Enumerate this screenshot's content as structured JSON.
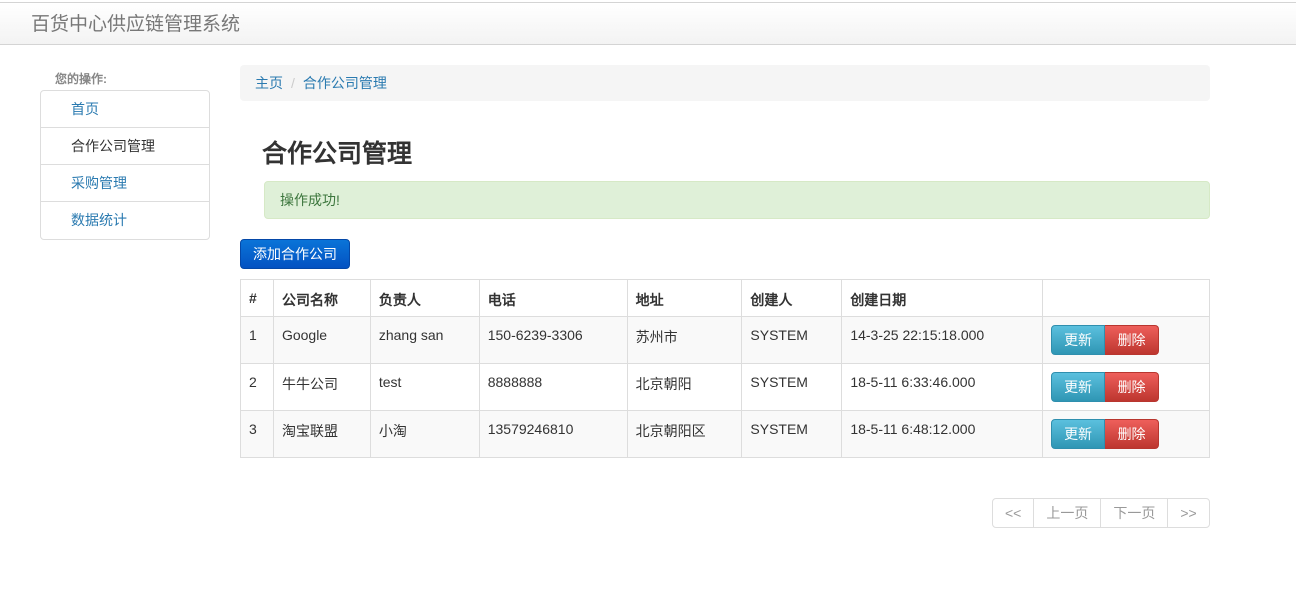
{
  "app": {
    "title": "百货中心供应链管理系统"
  },
  "sidebar": {
    "heading": "您的操作:",
    "items": [
      {
        "label": "首页"
      },
      {
        "label": "合作公司管理"
      },
      {
        "label": "采购管理"
      },
      {
        "label": "数据统计"
      }
    ]
  },
  "breadcrumb": {
    "home": "主页",
    "separator": "/",
    "current": "合作公司管理"
  },
  "page": {
    "title": "合作公司管理"
  },
  "alert": {
    "message": "操作成功!"
  },
  "toolbar": {
    "add_label": "添加合作公司"
  },
  "table": {
    "headers": [
      "#",
      "公司名称",
      "负责人",
      "电话",
      "地址",
      "创建人",
      "创建日期",
      ""
    ],
    "rows": [
      {
        "id": "1",
        "name": "Google",
        "owner": "zhang san",
        "phone": "150-6239-3306",
        "address": "苏州市",
        "creator": "SYSTEM",
        "created": "14-3-25 22:15:18.000"
      },
      {
        "id": "2",
        "name": "牛牛公司",
        "owner": "test",
        "phone": "8888888",
        "address": "北京朝阳",
        "creator": "SYSTEM",
        "created": "18-5-11 6:33:46.000"
      },
      {
        "id": "3",
        "name": "淘宝联盟",
        "owner": "小淘",
        "phone": "13579246810",
        "address": "北京朝阳区",
        "creator": "SYSTEM",
        "created": "18-5-11 6:48:12.000"
      }
    ],
    "update_label": "更新",
    "delete_label": "删除"
  },
  "pagination": {
    "first": "<<",
    "prev": "上一页",
    "next": "下一页",
    "last": ">>"
  },
  "colors": {
    "link": "#2a7ab0",
    "primary": "#0352c2",
    "info": "#2f96b4",
    "danger": "#bd362f",
    "success_bg": "#dff0d8"
  }
}
